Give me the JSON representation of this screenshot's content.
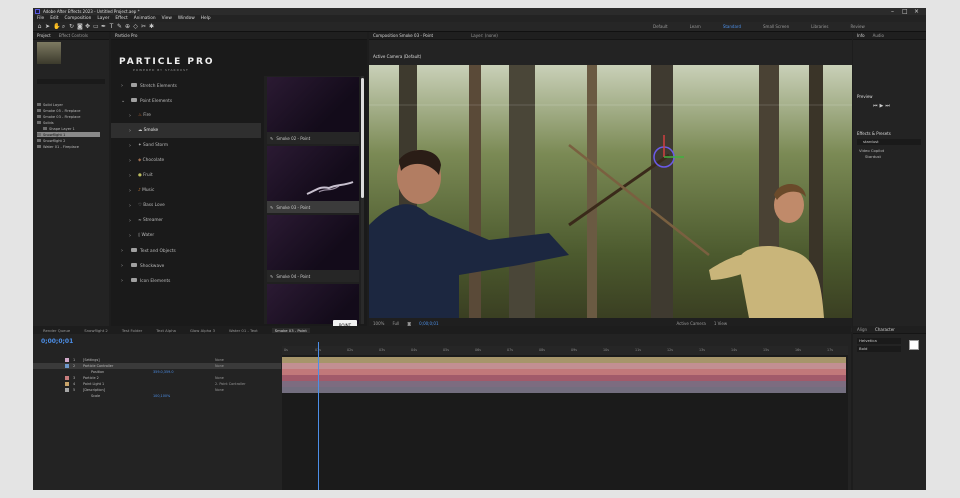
{
  "app": {
    "title": "Adobe After Effects 2023 - Untitled Project.aep *",
    "menus": [
      "File",
      "Edit",
      "Composition",
      "Layer",
      "Effect",
      "Animation",
      "View",
      "Window",
      "Help"
    ],
    "workspaces": [
      "Default",
      "Learn",
      "Standard",
      "Small Screen",
      "Libraries",
      "Review"
    ],
    "active_workspace": "Standard"
  },
  "project": {
    "tabs": [
      "Project",
      "Effect Controls"
    ],
    "items": [
      "Solid Layer",
      "Smoke 05 - Fireplace",
      "Smoke 03 - Fireplace",
      "Solids",
      "Shape Layer 1",
      "Snowflight 1",
      "Snowflight 2",
      "Water 01 - Fireplace"
    ],
    "selected_index": 5
  },
  "particle_pro": {
    "panel_tab": "Particle Pro",
    "logo": "PARTICLE PRO",
    "subtitle": "POWERED BY STARDUST",
    "categories": [
      {
        "label": "Stretch Elements",
        "level": 0,
        "expanded": false
      },
      {
        "label": "Point Elements",
        "level": 0,
        "expanded": true
      },
      {
        "label": "Fire",
        "level": 1
      },
      {
        "label": "Smoke",
        "level": 1,
        "selected": true
      },
      {
        "label": "Sand Storm",
        "level": 1
      },
      {
        "label": "Chocolate",
        "level": 1
      },
      {
        "label": "Fruit",
        "level": 1
      },
      {
        "label": "Music",
        "level": 1
      },
      {
        "label": "Bass Love",
        "level": 1
      },
      {
        "label": "Streamer",
        "level": 1
      },
      {
        "label": "Water",
        "level": 1
      },
      {
        "label": "Text and Objects",
        "level": 0,
        "expanded": false
      },
      {
        "label": "Shockwave",
        "level": 0,
        "expanded": false
      },
      {
        "label": "Icon Elements",
        "level": 0,
        "expanded": false
      }
    ],
    "presets": [
      {
        "label": "Smoke 02 - Point",
        "selected": false
      },
      {
        "label": "Smoke 03 - Point",
        "selected": true
      },
      {
        "label": "Smoke 04 - Point",
        "selected": false
      }
    ],
    "apply_button": "POINT"
  },
  "composition": {
    "tab": "Composition Smoke 03 - Point",
    "layer_tab": "Layer: (none)",
    "camera": "Active Camera (Default)",
    "zoom": "100%",
    "resolution": "Full",
    "timecode": "0;00;0;01",
    "view": "Active Camera",
    "views": "1 View"
  },
  "right_panels": {
    "tabs": [
      "Info",
      "Audio"
    ],
    "preview_label": "Preview",
    "effects_label": "Effects & Presets",
    "search_value": "stardust",
    "tree": [
      "Video Copilot",
      "Stardust"
    ]
  },
  "timeline": {
    "tabs": [
      "Render Queue",
      "Snowflight 2",
      "Test Folder",
      "Text Alpha",
      "Glow Alpha 3",
      "Water 01 - Text",
      "Smoke 03 - Point"
    ],
    "active_tab_index": 6,
    "timecode": "0;00;0;01",
    "layers": [
      {
        "num": "1",
        "name": "[Settings]",
        "color": "#d1a9c9",
        "parent": "None"
      },
      {
        "num": "2",
        "name": "Particle Controller",
        "color": "#6d97c9",
        "parent": "None",
        "selected": true
      },
      {
        "num": "",
        "name": "Position",
        "color": "#888888",
        "parent": "",
        "value": "359.0,359.0"
      },
      {
        "num": "3",
        "name": "Particle 2",
        "color": "#c87d7d",
        "parent": "None"
      },
      {
        "num": "4",
        "name": "Point Light 1",
        "color": "#c9a46a",
        "parent": "2. Point Controller"
      },
      {
        "num": "5",
        "name": "[Description]",
        "color": "#a6a6a6",
        "parent": "None"
      },
      {
        "num": "",
        "name": "Scale",
        "color": "#888888",
        "parent": "",
        "value": "100,100%"
      }
    ],
    "ruler": [
      "0s",
      "01s",
      "02s",
      "03s",
      "04s",
      "05s",
      "06s",
      "07s",
      "08s",
      "09s",
      "10s",
      "11s",
      "12s",
      "13s",
      "14s",
      "15s",
      "16s",
      "17s"
    ],
    "track_colors": [
      "#a6956a",
      "#c28f92",
      "#c2787a",
      "#a25a6a",
      "#7d6c80",
      "#736e7f"
    ]
  },
  "character": {
    "tabs": [
      "Align",
      "Character"
    ],
    "font": "Helvetica",
    "style": "Bold"
  }
}
